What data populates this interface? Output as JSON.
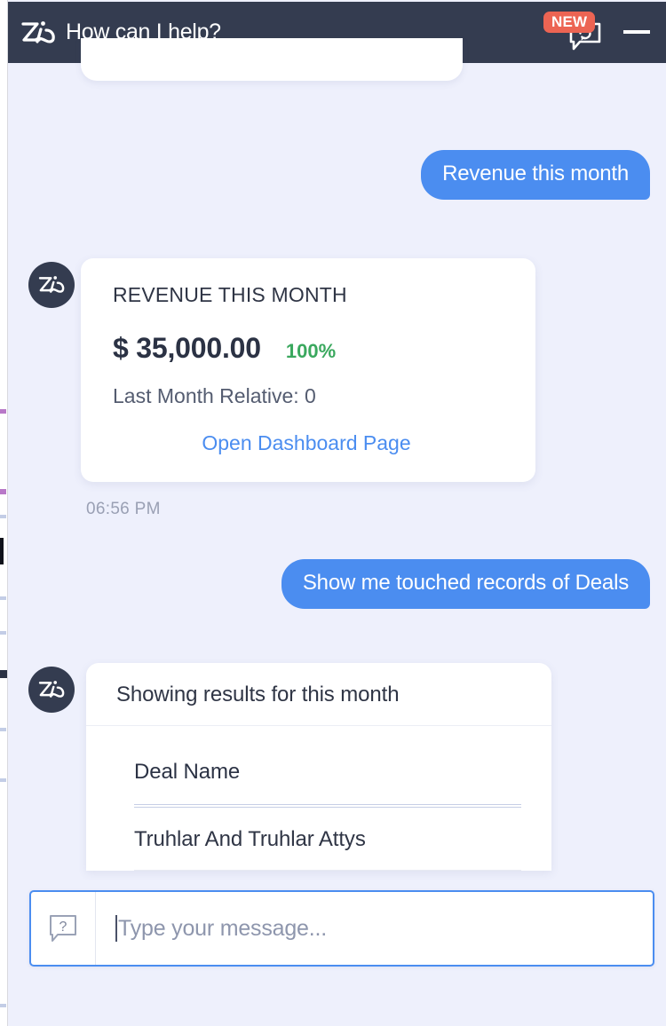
{
  "colors": {
    "header_bg": "#343c50",
    "window_bg": "#eef0fc",
    "accent_blue": "#4b8df0",
    "badge_red": "#ec6453",
    "positive_green": "#3aa85e",
    "card_white": "#ffffff",
    "muted_text": "#9aa0b4"
  },
  "header": {
    "logo_icon": "zia-logo-icon",
    "title": "How can I help?",
    "new_badge_label": "NEW",
    "new_chat_icon": "chat-refresh-icon",
    "minimize_icon": "minimize-icon"
  },
  "conversation": {
    "user_message_1": "Revenue this month",
    "user_message_2": "Show me touched records of Deals",
    "assistant_avatar_icon": "zia-avatar-icon",
    "revenue_card": {
      "title": "REVENUE THIS MONTH",
      "amount": "$ 35,000.00",
      "delta": "100%",
      "comparison": "Last Month Relative: 0",
      "link_label": "Open Dashboard Page",
      "timestamp": "06:56 PM"
    },
    "results_card": {
      "header": "Showing results for this month",
      "columns": [
        "Deal Name"
      ],
      "rows": [
        [
          "Truhlar And Truhlar Attys"
        ]
      ]
    }
  },
  "composer": {
    "help_icon": "help-bubble-icon",
    "value": "",
    "placeholder": "Type your message..."
  }
}
